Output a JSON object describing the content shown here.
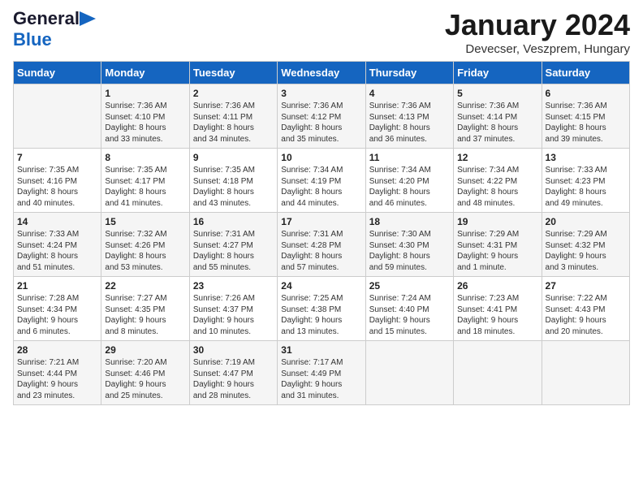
{
  "header": {
    "logo_line1": "General",
    "logo_line2": "Blue",
    "title": "January 2024",
    "subtitle": "Devecser, Veszprem, Hungary"
  },
  "days_of_week": [
    "Sunday",
    "Monday",
    "Tuesday",
    "Wednesday",
    "Thursday",
    "Friday",
    "Saturday"
  ],
  "weeks": [
    [
      {
        "day": "",
        "info": ""
      },
      {
        "day": "1",
        "info": "Sunrise: 7:36 AM\nSunset: 4:10 PM\nDaylight: 8 hours\nand 33 minutes."
      },
      {
        "day": "2",
        "info": "Sunrise: 7:36 AM\nSunset: 4:11 PM\nDaylight: 8 hours\nand 34 minutes."
      },
      {
        "day": "3",
        "info": "Sunrise: 7:36 AM\nSunset: 4:12 PM\nDaylight: 8 hours\nand 35 minutes."
      },
      {
        "day": "4",
        "info": "Sunrise: 7:36 AM\nSunset: 4:13 PM\nDaylight: 8 hours\nand 36 minutes."
      },
      {
        "day": "5",
        "info": "Sunrise: 7:36 AM\nSunset: 4:14 PM\nDaylight: 8 hours\nand 37 minutes."
      },
      {
        "day": "6",
        "info": "Sunrise: 7:36 AM\nSunset: 4:15 PM\nDaylight: 8 hours\nand 39 minutes."
      }
    ],
    [
      {
        "day": "7",
        "info": "Sunrise: 7:35 AM\nSunset: 4:16 PM\nDaylight: 8 hours\nand 40 minutes."
      },
      {
        "day": "8",
        "info": "Sunrise: 7:35 AM\nSunset: 4:17 PM\nDaylight: 8 hours\nand 41 minutes."
      },
      {
        "day": "9",
        "info": "Sunrise: 7:35 AM\nSunset: 4:18 PM\nDaylight: 8 hours\nand 43 minutes."
      },
      {
        "day": "10",
        "info": "Sunrise: 7:34 AM\nSunset: 4:19 PM\nDaylight: 8 hours\nand 44 minutes."
      },
      {
        "day": "11",
        "info": "Sunrise: 7:34 AM\nSunset: 4:20 PM\nDaylight: 8 hours\nand 46 minutes."
      },
      {
        "day": "12",
        "info": "Sunrise: 7:34 AM\nSunset: 4:22 PM\nDaylight: 8 hours\nand 48 minutes."
      },
      {
        "day": "13",
        "info": "Sunrise: 7:33 AM\nSunset: 4:23 PM\nDaylight: 8 hours\nand 49 minutes."
      }
    ],
    [
      {
        "day": "14",
        "info": "Sunrise: 7:33 AM\nSunset: 4:24 PM\nDaylight: 8 hours\nand 51 minutes."
      },
      {
        "day": "15",
        "info": "Sunrise: 7:32 AM\nSunset: 4:26 PM\nDaylight: 8 hours\nand 53 minutes."
      },
      {
        "day": "16",
        "info": "Sunrise: 7:31 AM\nSunset: 4:27 PM\nDaylight: 8 hours\nand 55 minutes."
      },
      {
        "day": "17",
        "info": "Sunrise: 7:31 AM\nSunset: 4:28 PM\nDaylight: 8 hours\nand 57 minutes."
      },
      {
        "day": "18",
        "info": "Sunrise: 7:30 AM\nSunset: 4:30 PM\nDaylight: 8 hours\nand 59 minutes."
      },
      {
        "day": "19",
        "info": "Sunrise: 7:29 AM\nSunset: 4:31 PM\nDaylight: 9 hours\nand 1 minute."
      },
      {
        "day": "20",
        "info": "Sunrise: 7:29 AM\nSunset: 4:32 PM\nDaylight: 9 hours\nand 3 minutes."
      }
    ],
    [
      {
        "day": "21",
        "info": "Sunrise: 7:28 AM\nSunset: 4:34 PM\nDaylight: 9 hours\nand 6 minutes."
      },
      {
        "day": "22",
        "info": "Sunrise: 7:27 AM\nSunset: 4:35 PM\nDaylight: 9 hours\nand 8 minutes."
      },
      {
        "day": "23",
        "info": "Sunrise: 7:26 AM\nSunset: 4:37 PM\nDaylight: 9 hours\nand 10 minutes."
      },
      {
        "day": "24",
        "info": "Sunrise: 7:25 AM\nSunset: 4:38 PM\nDaylight: 9 hours\nand 13 minutes."
      },
      {
        "day": "25",
        "info": "Sunrise: 7:24 AM\nSunset: 4:40 PM\nDaylight: 9 hours\nand 15 minutes."
      },
      {
        "day": "26",
        "info": "Sunrise: 7:23 AM\nSunset: 4:41 PM\nDaylight: 9 hours\nand 18 minutes."
      },
      {
        "day": "27",
        "info": "Sunrise: 7:22 AM\nSunset: 4:43 PM\nDaylight: 9 hours\nand 20 minutes."
      }
    ],
    [
      {
        "day": "28",
        "info": "Sunrise: 7:21 AM\nSunset: 4:44 PM\nDaylight: 9 hours\nand 23 minutes."
      },
      {
        "day": "29",
        "info": "Sunrise: 7:20 AM\nSunset: 4:46 PM\nDaylight: 9 hours\nand 25 minutes."
      },
      {
        "day": "30",
        "info": "Sunrise: 7:19 AM\nSunset: 4:47 PM\nDaylight: 9 hours\nand 28 minutes."
      },
      {
        "day": "31",
        "info": "Sunrise: 7:17 AM\nSunset: 4:49 PM\nDaylight: 9 hours\nand 31 minutes."
      },
      {
        "day": "",
        "info": ""
      },
      {
        "day": "",
        "info": ""
      },
      {
        "day": "",
        "info": ""
      }
    ]
  ]
}
